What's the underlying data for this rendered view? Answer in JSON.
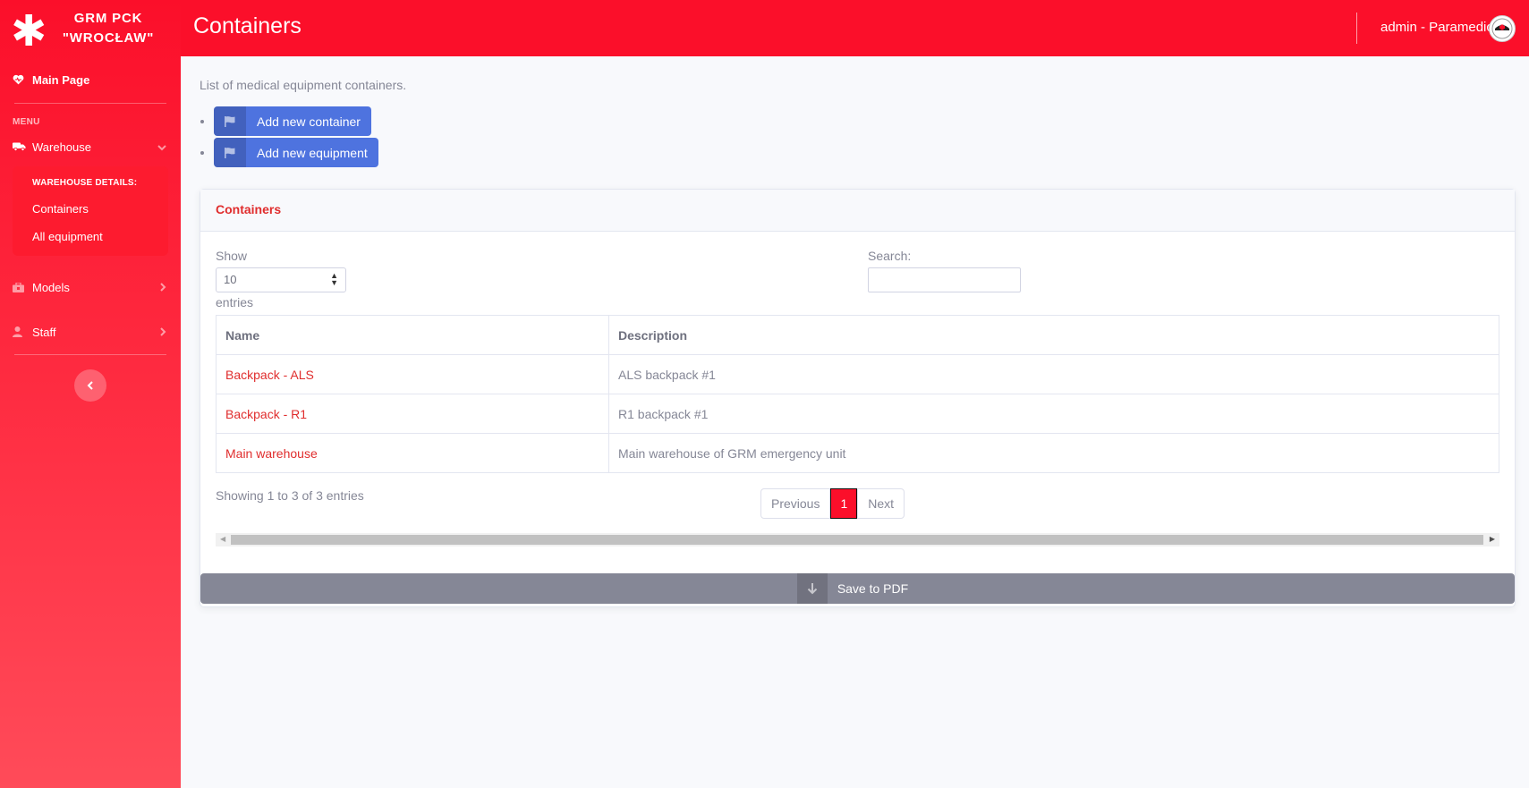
{
  "brand": {
    "line1": "GRM PCK",
    "line2": "\"WROCŁAW\"",
    "icon": "asterisk-icon"
  },
  "sidebar": {
    "main_page": "Main Page",
    "heading": "MENU",
    "warehouse": "Warehouse",
    "warehouse_details_header": "WAREHOUSE DETAILS:",
    "containers": "Containers",
    "all_equipment": "All equipment",
    "models": "Models",
    "staff": "Staff"
  },
  "topbar": {
    "title": "Containers",
    "user": "admin - Paramedic"
  },
  "main": {
    "intro": "List of medical equipment containers.",
    "actions": [
      "Add new container",
      "Add new equipment"
    ]
  },
  "card": {
    "title": "Containers",
    "show_label": "Show",
    "page_size": "10",
    "entries_label": "entries",
    "search_label": "Search:",
    "search_value": "",
    "columns": [
      "Name",
      "Description"
    ],
    "rows": [
      {
        "name": "Backpack - ALS",
        "description": "ALS backpack #1"
      },
      {
        "name": "Backpack - R1",
        "description": "R1 backpack #1"
      },
      {
        "name": "Main warehouse",
        "description": "Main warehouse of GRM emergency unit"
      }
    ],
    "info": "Showing 1 to 3 of 3 entries",
    "pagination": {
      "previous": "Previous",
      "current": "1",
      "next": "Next"
    },
    "save_pdf": "Save to PDF"
  },
  "colors": {
    "primary_red": "#fb0f2a",
    "button_blue": "#4e73df",
    "link_red": "#e02d2d",
    "gray": "#858796"
  }
}
